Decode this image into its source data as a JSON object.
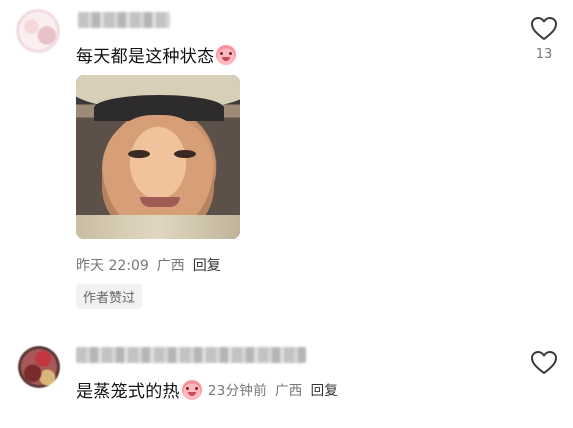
{
  "comments": [
    {
      "text": "每天都是这种状态",
      "emoji": "crying-face-emoji",
      "time": "昨天 22:09",
      "location": "广西",
      "reply_label": "回复",
      "author_liked_label": "作者赞过",
      "like_count": "13"
    },
    {
      "text": "是蒸笼式的热",
      "emoji": "crying-face-emoji",
      "time": "23分钟前",
      "location": "广西",
      "reply_label": "回复"
    }
  ]
}
